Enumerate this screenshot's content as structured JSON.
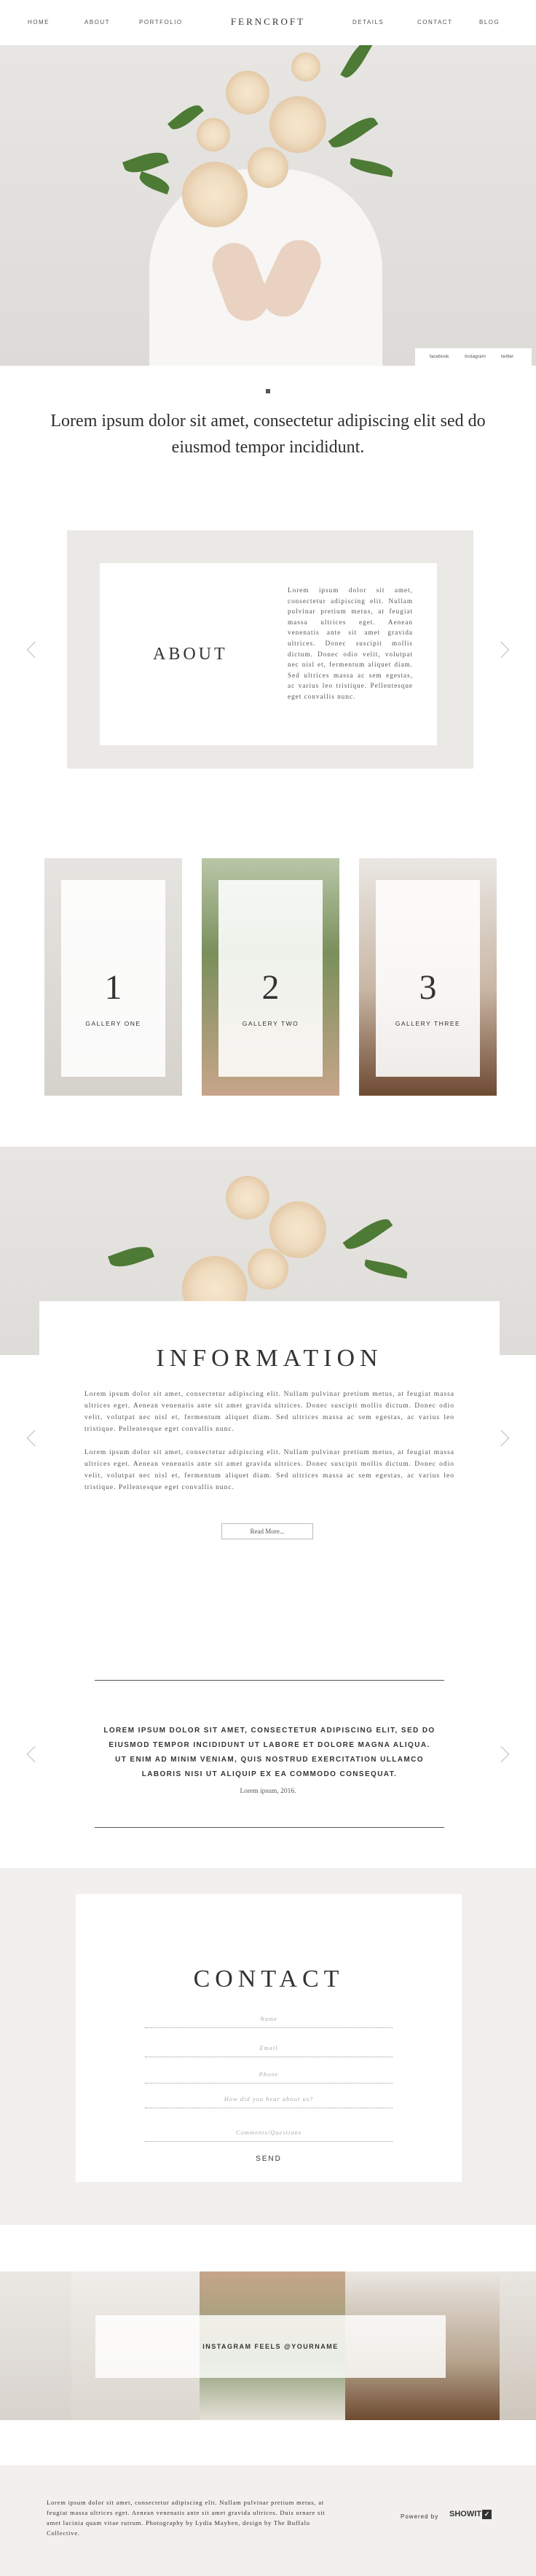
{
  "nav": {
    "brand": "FERNCROFT",
    "left": [
      "HOME",
      "ABOUT",
      "PORTFOLIO"
    ],
    "right": [
      "DETAILS",
      "CONTACT",
      "BLOG"
    ]
  },
  "hero": {
    "social": [
      "facebook",
      "Instagram",
      "twitter"
    ]
  },
  "lead": "Lorem ipsum dolor sit amet, consectetur adipiscing elit sed do eiusmod tempor incididunt.",
  "about": {
    "title": "ABOUT",
    "text": "Lorem ipsum dolor sit amet, consectetur adipiscing elit. Nullam pulvinar pretium metus, at feugiat massa ultrices eget. Aenean venenatis ante sit amet gravida ultrices. Donec suscipit mollis dictum. Donec odio velit, volutpat nec nisl et, fermentum aliquet diam. Sed ultrices massa ac sem egestas, ac varius leo tristique. Pellentesque eget convallis nunc."
  },
  "galleries": [
    {
      "num": "1",
      "label": "GALLERY ONE"
    },
    {
      "num": "2",
      "label": "GALLERY TWO"
    },
    {
      "num": "3",
      "label": "GALLERY THREE"
    }
  ],
  "information": {
    "title": "INFORMATION",
    "p1": "Lorem ipsum dolor sit amet, consectetur adipiscing elit. Nullam pulvinar pretium metus, at feugiat massa ultrices eget. Aenean venenatis ante sit amet gravida ultrices. Donec suscipit mollis dictum. Donec odio velit, volutpat nec nisl et, fermentum aliquet diam. Sed ultrices massa ac sem egestas, ac varius leo tristique. Pellentesque eget convallis nunc.",
    "p2": "Lorem ipsum dolor sit amet, consectetur adipiscing elit. Nullam pulvinar pretium metus, at feugiat massa ultrices eget. Aenean venenatis ante sit amet gravida ultrices. Donec suscipit mollis dictum. Donec odio velit, volutpat nec nisl et, fermentum aliquet diam. Sed ultrices massa ac sem egestas, ac varius leo tristique. Pellentesque eget convallis nunc.",
    "button": "Read More..."
  },
  "testimonial": {
    "quote": "LOREM IPSUM DOLOR SIT AMET, CONSECTETUR ADIPISCING ELIT, SED DO EIUSMOD TEMPOR INCIDIDUNT UT LABORE ET DOLORE MAGNA ALIQUA. UT ENIM AD MINIM VENIAM, QUIS NOSTRUD EXERCITATION ULLAMCO LABORIS NISI UT ALIQUIP EX EA COMMODO CONSEQUAT.",
    "by": "Lorem ipsum, 2016."
  },
  "contact": {
    "title": "CONTACT",
    "fields": [
      "Name",
      "Email",
      "Phone",
      "How did you hear about us?",
      "Comments/Questions"
    ],
    "send": "SEND"
  },
  "instagram": {
    "label": "INSTAGRAM FEELS @YOURNAME"
  },
  "footer": {
    "text": "Lorem ipsum dolor sit amet, consectetur adipiscing elit. Nullam pulvinar pretium metus, at feugiat massa ultrices eget. Aenean venenatis ante sit amet gravida ultrices. Duis ornare sit amet lacinia quam vitae rutrum. Photography by Lydia Mayben, design by The Buffalo Collective.",
    "powered": "Powered by",
    "showit": "SHOWIT",
    "showit_mark": "✓"
  }
}
